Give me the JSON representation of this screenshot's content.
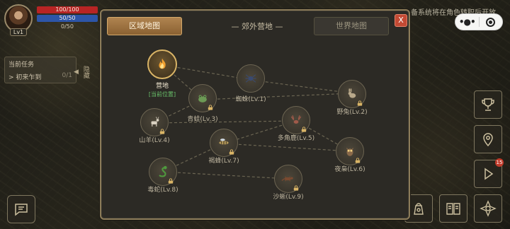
{
  "hud": {
    "level": "Lv1",
    "hp": "100/100",
    "mp": "50/50",
    "xp": "0/50"
  },
  "quest": {
    "title": "当前任务",
    "item": "> 初来乍到",
    "progress": "0/1",
    "hide_label": "隐藏"
  },
  "notice": "备系统将在角色转职后开放",
  "capsule": {
    "more_label": "•●•"
  },
  "map": {
    "tab_region": "区域地图",
    "tab_world": "世界地图",
    "title": "— 郊外营地 —",
    "close": "X",
    "nodes": [
      {
        "id": "camp",
        "name": "营地",
        "status": "[当前位置]",
        "icon": "campfire-icon",
        "locked": false
      },
      {
        "id": "spider",
        "name": "蜘蛛(Lv.1)",
        "icon": "spider-icon",
        "locked": false
      },
      {
        "id": "frog",
        "name": "青蛙(Lv.3)",
        "icon": "frog-icon",
        "locked": true
      },
      {
        "id": "rabbit",
        "name": "野兔(Lv.2)",
        "icon": "rabbit-icon",
        "locked": true
      },
      {
        "id": "goat",
        "name": "山羊(Lv.4)",
        "icon": "goat-icon",
        "locked": true
      },
      {
        "id": "deer",
        "name": "多角鹿(Lv.5)",
        "icon": "deer-icon",
        "locked": true
      },
      {
        "id": "wasp",
        "name": "褐蜂(Lv.7)",
        "icon": "wasp-icon",
        "locked": true
      },
      {
        "id": "owl",
        "name": "夜枭(Lv.6)",
        "icon": "owl-icon",
        "locked": true
      },
      {
        "id": "snake",
        "name": "毒蛇(Lv.8)",
        "icon": "snake-icon",
        "locked": true
      },
      {
        "id": "lizard",
        "name": "沙蜥(Lv.9)",
        "icon": "lizard-icon",
        "locked": true
      }
    ]
  },
  "side": {
    "mail_badge": "15"
  },
  "colors": {
    "accent": "#b08450",
    "hp": "#b82424",
    "mp": "#2d55a8",
    "current_location": "#69c06a",
    "close": "#c34a34"
  }
}
